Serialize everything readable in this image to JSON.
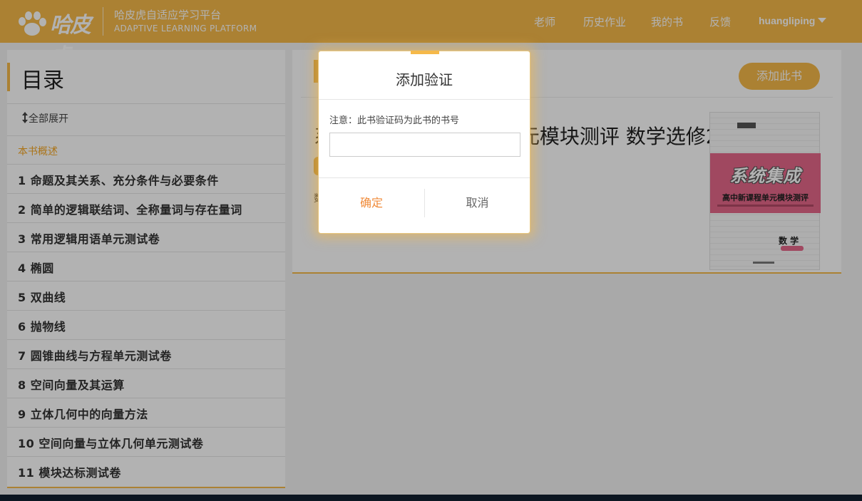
{
  "header": {
    "logo_text": "哈皮虎",
    "brand_cn": "哈皮虎自适应学习平台",
    "brand_en": "ADAPTIVE LEARNING PLATFORM",
    "nav": [
      "老师",
      "历史作业",
      "我的书",
      "反馈"
    ],
    "user": "huangliping"
  },
  "sidebar": {
    "title": "目录",
    "expand_all": "全部展开",
    "overview": "本书概述",
    "items": [
      "1  命题及其关系、充分条件与必要条件",
      "2  简单的逻辑联结词、全称量词与存在量词",
      "3  常用逻辑用语单元测试卷",
      "4  椭圆",
      "5  双曲线",
      "6  抛物线",
      "7  圆锥曲线与方程单元测试卷",
      "8  空间向量及其运算",
      "9  立体几何中的向量方法",
      "10  空间向量与立体几何单元测试卷",
      "11  模块达标测试卷"
    ]
  },
  "main": {
    "add_book_button": "添加此书",
    "book_title": "系统集成 高中新课程单元模块测评 数学选修2-1",
    "book_meta": "数",
    "cover": {
      "brand": "系统集成",
      "subtitle": "高中新课程单元模块测评",
      "subject": "数 学"
    }
  },
  "modal": {
    "title": "添加验证",
    "note": "注意：此书验证码为此书的书号",
    "input_value": "",
    "input_placeholder": "",
    "confirm": "确定",
    "cancel": "取消"
  },
  "colors": {
    "accent": "#f5b94a",
    "confirm_text": "#f08b3a",
    "cover_band": "#e5678a"
  }
}
